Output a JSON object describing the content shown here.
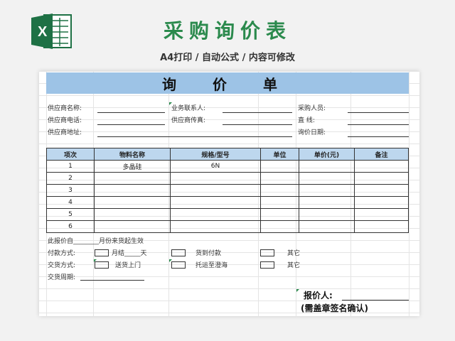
{
  "header": {
    "title": "采购询价表",
    "subtitle": "A4打印 / 自动公式 / 内容可修改"
  },
  "sheet": {
    "heading": "询 价 单",
    "supplier_name": "供应商名称:",
    "supplier_phone": "供应商电话:",
    "supplier_address": "供应商地址:",
    "contact": "业务联系人:",
    "fax": "供应商传真:",
    "buyer": "采购人员:",
    "direct": "直    线:",
    "inquiry_date": "询价日期:",
    "columns": [
      "项次",
      "物料名称",
      "规格/型号",
      "单位",
      "单价(元)",
      "备注"
    ],
    "rows": [
      {
        "no": "1",
        "name": "多晶硅",
        "spec": "6N",
        "unit": "",
        "price": "",
        "note": ""
      },
      {
        "no": "2",
        "name": "",
        "spec": "",
        "unit": "",
        "price": "",
        "note": ""
      },
      {
        "no": "3",
        "name": "",
        "spec": "",
        "unit": "",
        "price": "",
        "note": ""
      },
      {
        "no": "4",
        "name": "",
        "spec": "",
        "unit": "",
        "price": "",
        "note": ""
      },
      {
        "no": "5",
        "name": "",
        "spec": "",
        "unit": "",
        "price": "",
        "note": ""
      },
      {
        "no": "6",
        "name": "",
        "spec": "",
        "unit": "",
        "price": "",
        "note": ""
      }
    ],
    "validity": "此报价自________月份来货起生效",
    "payment_label": "付款方式:",
    "payment_monthly": "月结_____天",
    "payment_cod": "货到付款",
    "payment_other": "其它",
    "delivery_label": "交货方式:",
    "delivery_door": "送货上门",
    "delivery_shipping": "托运至澄海",
    "delivery_other": "其它",
    "delivery_cycle": "交货周期:",
    "quoter": "报价人:",
    "seal_note": "(需盖章签名确认)"
  },
  "colors": {
    "brand": "#2b8a4d",
    "heading_band": "#9dc3e6",
    "table_header": "#bdd7ee"
  }
}
